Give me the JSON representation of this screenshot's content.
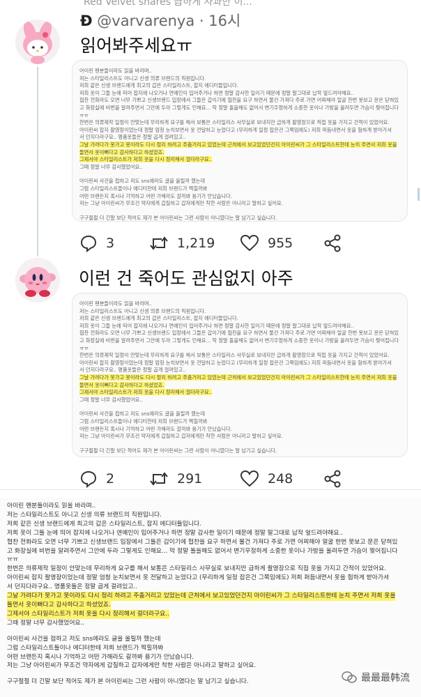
{
  "top_cut_text": "Red Velvet shares 급하게 사과한 이...",
  "tweets": [
    {
      "name": "Ð",
      "handle": "@varvarenya",
      "dot": "·",
      "time": "16시",
      "text": "읽어봐주세요ㅠ",
      "card_lines": [
        "아이린 팬분들이라도 읽을 바라며..",
        "저는 스타일리스트도 아니고 신생 의류 브랜드의 직원입니다.",
        "저희 같은 신생 브랜드에게 최고의 갑은 스타일리스트, 잡지 에디터들입니다.",
        "저희 옷이 그들 눈에 띄어 잡지에 나오거나 연예인이 입어주거나 하면 정말 감사한 일이기 때문에 정말 말그대로 납작 엎드려야해요..",
        "협찬 전화라도 오면 너무 기쁘고 신생브랜드 입장에서 그들은 갑이기에 협찬을 요구 하면서 물건 가져다 주로 가면 어찌해야 얼굴 한번 못보고 문은 닫혀있",
        "고 화장실에 비번을 알려주면서 그안에 두라 그렇게도 인해요... 막 정말 돌을해도 없어서 변기우정하게 소중한 옷이나 가방을 올려두면 가슴이 찢어집니다",
        "ㅠㅠ",
        "한번은 의류제작 일정이 안맞는데 무리하게 요구를 해서 보통은 스타일리스 사무실로 보내지만 급하게 촬영장으로 직접 옷을 가지고 간적이 있었어요.",
        "아이린씨 잡지 촬영장이었는데 정말 엄청 눈치보면서 옷 전달하고 눈었다고 (무리하게 일정 잡은건 그쪽임에도) 저희 퍼듬내면서 옷을 험하게 받아가셔",
        "서 던지다라구요.. 명품옷들은 정말 곱게 걸려있고..",
        "그날 가려다가 못가고 못이라도 다시 정리 하려고 주춤거리고 있었는데 근처에서 보고있었던건지 아이린씨가 그 스타일리스트한테 눈치 주면서 저희 옷을",
        "들면서 옷이뻐다고 감사하다고 하셨었죠.",
        "그제서야 스타일리스트가 저희 옷을 다시 정리해서 걸더라구요..",
        "그때 정말 너무 감사했었어요..",
        "",
        "아이린씨 사건을 접하고 저도 sns에라도 글을 올릴까 했는데",
        "그럼 스타일리스트들이나 에디터한테 저희 브랜드가 찍힐까봐",
        "어떤 브랜든지 혹시나 기억하고 어떤 가해라도 갈까봐 용기가 안났습니다.",
        "저는 그냥 아이린씨가 무조건 약자에게 갑질하고 갑자에게만 착한 사람은 아니라고 말하고 싶어요.",
        "",
        "구구절절 더 긴말 보단 적어도 제가 본 아이린씨는 그런 사람이 아니였다는 말 남기고 싶습니다."
      ],
      "replies": "3",
      "retweets": "1,219",
      "likes": "955"
    },
    {
      "name": "",
      "handle": "",
      "dot": "",
      "time": "",
      "text": "이런 건 죽어도 관심없지 아주",
      "card_lines": [
        "아이린 팬분들이라도 읽을 바라며..",
        "저는 스타일리스트도 아니고 신생 의류 브랜드의 직원입니다.",
        "저희 같은 신생 브랜드에게 최고의 갑은 스타일리스트, 잡지 에디터들입니다.",
        "저희 옷이 그들 눈에 띄어 잡지에 나오거나 연예인이 입어주거나 하면 정말 감사한 일이기 때문에 정말 말그대로 납작 엎드려야해요..",
        "협찬 전화라도 오면 너무 기쁘고 신생브랜드 입장에서 그들은 갑이기에 협찬을 요구 하면서 물건 가져다 주로 가면 어찌해야 얼굴 한번 못보고 문은 닫혀있",
        "고 화장실에 비번을 알려주면서 그안에 두라 그렇게도 인해요... 막 정말 돌을해도 없어서 변기우정하게 소중한 옷이나 가방을 올려두면 가슴이 찢어집니다",
        "ㅠㅠ",
        "한번은 의류제작 일정이 안맞는데 무리하게 요구를 해서 보통은 스타일리스 사무실로 보내지만 급하게 촬영장으로 직접 옷을 가지고 간적이 있었어요.",
        "아이린씨 잡지 촬영장이었는데 정말 엄청 눈치보면서 옷 전달하고 눈었다고 (무리하게 일정 잡은건 그쪽임에도) 저희 퍼듬내면서 옷을 험하게 받아가셔",
        "서 던지다라구요.. 명품옷들은 정말 곱게 걸려있고..",
        "그날 가려다가 못가고 못이라도 다시 정리 하려고 주춤거리고 있었는데 근처에서 보고있었던건지 아이린씨가 그 스타일리스트한테 눈치 주면서 저희 옷을",
        "들면서 옷이뻐다고 감사하다고 하셨었죠.",
        "그제서야 스타일리스트가 저희 옷을 다시 정리해서 걸더라구요..",
        "그때 정말 너무 감사했었어요..",
        "",
        "아이린씨 사건을 접하고 저도 sns에라도 글을 올릴까 했는데",
        "그럼 스타일리스트들이나 에디터한테 저희 브랜드가 찍힐까봐",
        "어떤 브랜든지 혹시나 기억하고 어떤 가해라도 갈까봐 용기가 안났습니다.",
        "저는 그냥 아이린씨가 무조건 약자에게 갑질하고 갑자에게만 착한 사람은 아니라고 말하고 싶어요.",
        "",
        "구구절절 더 긴말 보단 적어도 제가 본 아이린씨는 그런 사람이 아니였다는 말 남기고 싶습니다."
      ],
      "replies": "2",
      "retweets": "291",
      "likes": "248"
    }
  ],
  "paper_lines": [
    "아이린 팬분들이라도 읽을 바라며..",
    "저는 스타일리스트도 아니고 신생 의류 브랜드의 직원입니다.",
    "저희 같은 신생 브랜드에게 최고의 갑은 스타일리스트, 잡지 에디터들입니다.",
    "저희 옷이 그들 눈에 띄어 잡지에 나오거나 연예인이 입어주거나 하면 정말 감사한 일이기 때문에 정말 말그대로 납작 엎드려야해요..",
    "협찬 전화라도 오면 너무 기쁘고 신생브랜드 입장에서 그들은 갑이기에 협찬을 요구 하면서 물건 가져다 주로 가면 어찌해야 얼굴 한번 못보고 문은 닫혀있",
    "고 화장실에 비번을 알려주면서 그안에 두라 그렇게도 인해요... 막 정말 돌을해도 없어서 변기우정하게 소중한 옷이나 가방을 올려두면 가슴이 찢어집니다",
    "ㅠㅠ",
    "한번은 의류제작 일정이 안맞는데 무리하게 요구를 해서 보통은 스타일리스 사무실로 보내지만 급하게 촬영장으로 직접 옷을 가지고 간적이 있었어요.",
    "아이린씨 잡지 촬영장이었는데 정말 엄청 눈치보면서 옷 전달하고 눈었다고 (무리하게 일정 잡은건 그쪽임에도) 저희 퍼듬내면서 옷을 험하게 받아가셔",
    "서 던지다라구요.. 명품옷들은 정말 곱게 걸려있고..",
    "그날 가려다가 못가고 못이라도 다시 정리 하려고 주춤거리고 있었는데 근처에서 보고있었던건지 아이린씨가 그 스타일리스트한테 눈치 주면서 저희 옷을",
    "들면서 옷이뻐다고 감사하다고 하셨었죠.",
    "그제서야 스타일리스트가 저희 옷을 다시 정리해서 걸더라구요..",
    "그때 정말 너무 감사했었어요..",
    "",
    "아이린씨 사건을 접하고 저도 sns에라도 글을 올릴까 했는데",
    "그럼 스타일리스트들이나 에디터한테 저희 브랜드가 찍힐까봐",
    "어떤 브랜든지 혹시나 기억하고 어떤 가해라도 갈까봐 용기가 안났습니다.",
    "저는 그냥 아이린씨가 무조건 약자에게 갑질하고 갑자에게만 착한 사람은 아니라고 말하고 싶어요.",
    "",
    "구구절절 더 긴말 보단 적어도 제가 본 아이린씨는 그런 사람이 아니였다는 말 남기고 싶습니다."
  ],
  "highlight_indices": [
    10,
    11,
    12
  ],
  "watermark": "最最最韩流",
  "colors": {
    "highlight": "#fff46a",
    "icon": "#333333",
    "thread": "#cfd9de"
  }
}
